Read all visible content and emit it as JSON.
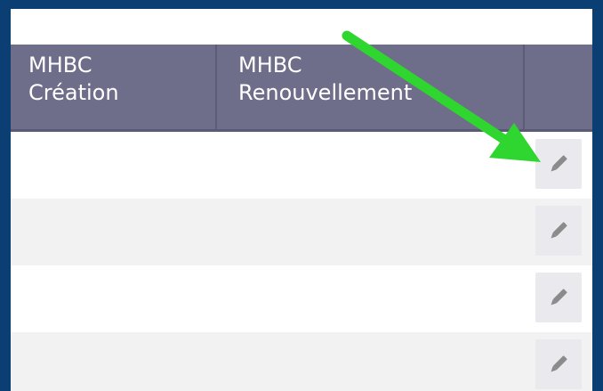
{
  "colors": {
    "frame_border": "#0b3f73",
    "header_bg": "#6f6e8a",
    "header_text": "#ffffff",
    "row_alt_bg": "#f2f2f2",
    "edit_button_bg": "#e9e9ee",
    "pencil_icon": "#8b8b8b",
    "annotation_arrow": "#2fd62f"
  },
  "table": {
    "columns": [
      {
        "line1": "MHBC",
        "line2": "Création"
      },
      {
        "line1": "MHBC",
        "line2": "Renouvellement"
      },
      {
        "line1": "",
        "line2": ""
      }
    ],
    "rows": [
      {
        "action_icon": "pencil-icon"
      },
      {
        "action_icon": "pencil-icon"
      },
      {
        "action_icon": "pencil-icon"
      },
      {
        "action_icon": "pencil-icon"
      }
    ]
  },
  "annotation": {
    "icon": "arrow-icon",
    "points_to": "edit-button-row-1"
  }
}
